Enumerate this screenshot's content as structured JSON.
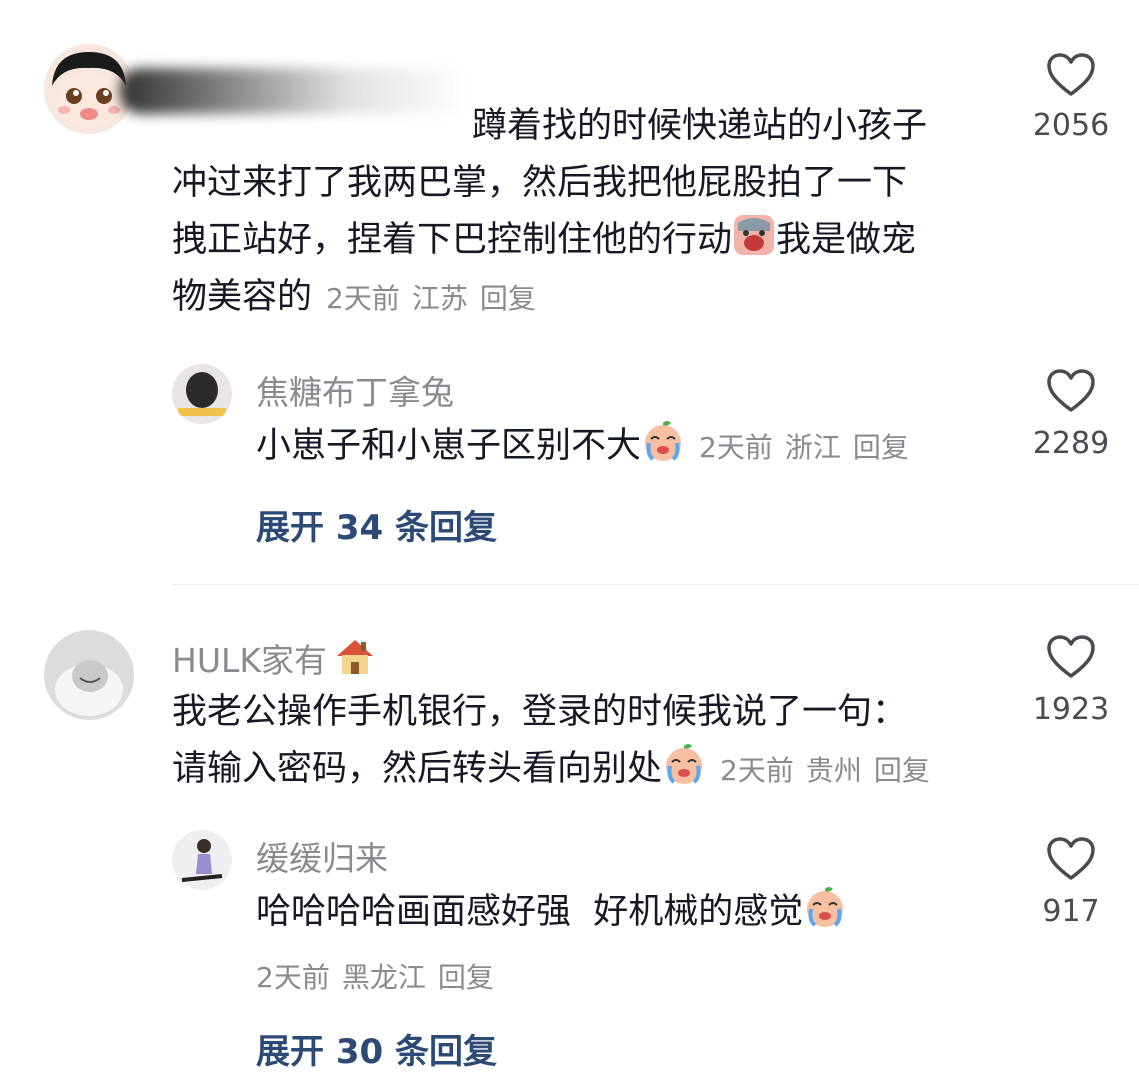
{
  "comments": [
    {
      "text_lines": [
        "蹲着找的时候快递站的小孩子",
        "冲过来打了我两巴掌，然后我把他屁股拍了一下",
        "拽正站好，捏着下巴控制住他的行动",
        "我是做宠",
        "物美容的"
      ],
      "time": "2天前",
      "location": "江苏",
      "reply_label": "回复",
      "likes": "2056",
      "replies": [
        {
          "username": "焦糖布丁拿兔",
          "text": "小崽子和小崽子区别不大",
          "time": "2天前",
          "location": "浙江",
          "reply_label": "回复",
          "likes": "2289"
        }
      ],
      "expand_label": "展开 34 条回复"
    },
    {
      "username": "HULK家有",
      "text_lines": [
        "我老公操作手机银行，登录的时候我说了一句：",
        "请输入密码，然后转头看向别处"
      ],
      "time": "2天前",
      "location": "贵州",
      "reply_label": "回复",
      "likes": "1923",
      "replies": [
        {
          "username": "缓缓归来",
          "text": "哈哈哈哈画面感好强  好机械的感觉",
          "time": "2天前",
          "location": "黑龙江",
          "reply_label": "回复",
          "likes": "917"
        }
      ],
      "expand_label": "展开 30 条回复"
    }
  ],
  "icons": {
    "like": "heart-outline-icon",
    "emoji_cry": "crying-emoji-icon",
    "emoji_scream": "screaming-emoji-icon",
    "emoji_house": "house-emoji-icon"
  },
  "colors": {
    "text": "#161823",
    "meta": "#8a8b91",
    "expand": "#2c4a75"
  }
}
